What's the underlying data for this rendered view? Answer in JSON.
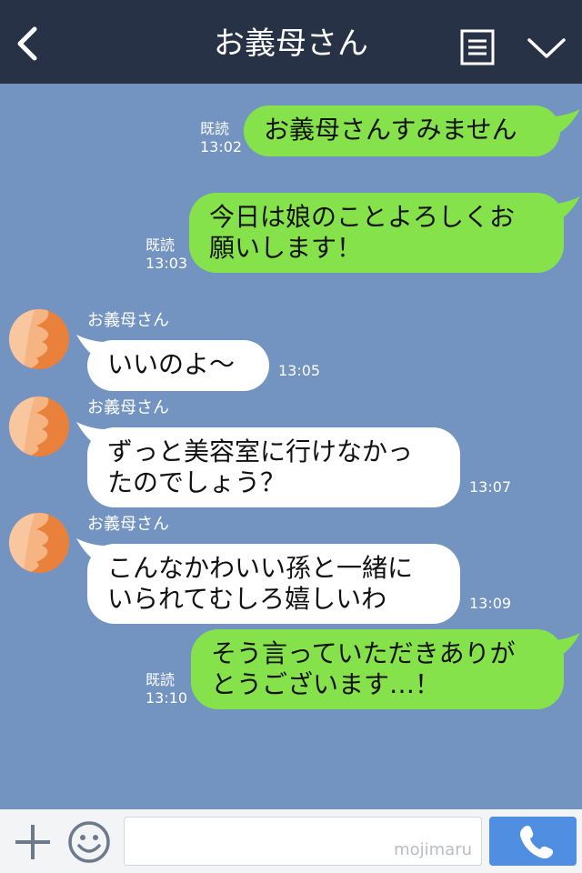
{
  "header": {
    "title": "お義母さん",
    "back_icon": "chevron-left-icon",
    "menu_icon": "menu-list-icon",
    "dropdown_icon": "chevron-down-icon"
  },
  "colors": {
    "header_bg": "#273246",
    "chat_bg": "#7393c0",
    "my_bubble": "#86e24a",
    "their_bubble": "#ffffff",
    "call_button": "#4f8ee0"
  },
  "messages": [
    {
      "from": "me",
      "text": "お義母さんすみません",
      "read": "既読",
      "time": "13:02"
    },
    {
      "from": "me",
      "text": "今日は娘のことよろしくお\n願いします！",
      "read": "既読",
      "time": "13:03"
    },
    {
      "from": "them",
      "sender": "お義母さん",
      "text": "いいのよ〜",
      "time": "13:05"
    },
    {
      "from": "them",
      "sender": "お義母さん",
      "text": "ずっと美容室に行けなかっ\nたのでしょう？",
      "time": "13:07"
    },
    {
      "from": "them",
      "sender": "お義母さん",
      "text": "こんなかわいい孫と一緒に\nいられてむしろ嬉しいわ",
      "time": "13:09"
    },
    {
      "from": "me",
      "text": "そう言っていただきありが\nとうございます…！",
      "read": "既読",
      "time": "13:10"
    }
  ],
  "footer": {
    "plus_icon": "plus-icon",
    "emoji_icon": "smiley-icon",
    "input_value": "",
    "watermark": "mojimaru",
    "call_icon": "phone-icon"
  }
}
